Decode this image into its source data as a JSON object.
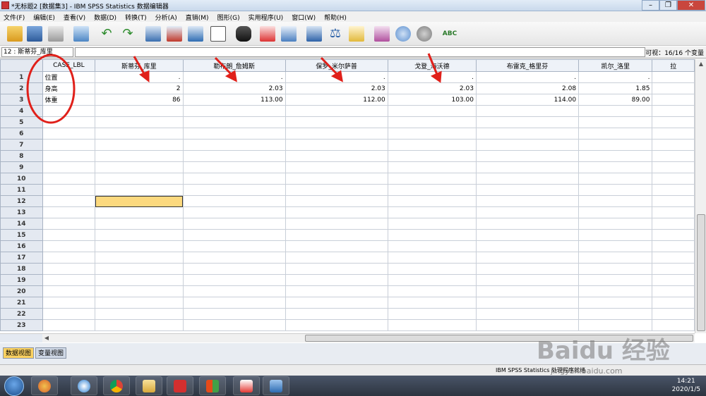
{
  "window": {
    "title": "*无标题2 [数据集3] - IBM SPSS Statistics 数据编辑器",
    "buttons": {
      "minimize": "–",
      "maximize": "❐",
      "close": "✕"
    }
  },
  "menu": [
    "文件(F)",
    "编辑(E)",
    "查看(V)",
    "数据(D)",
    "转换(T)",
    "分析(A)",
    "直销(M)",
    "图形(G)",
    "实用程序(U)",
    "窗口(W)",
    "帮助(H)"
  ],
  "toolbar": {
    "icons": [
      "open-icon",
      "save-icon",
      "print-icon",
      "dialog-recall-icon",
      "undo-icon",
      "redo-icon",
      "goto-case-icon",
      "goto-variable-icon",
      "variables-icon",
      "run-descriptives-icon",
      "find-icon",
      "insert-cases-icon",
      "insert-variable-icon",
      "split-file-icon",
      "weight-cases-icon",
      "select-cases-icon",
      "value-labels-icon",
      "use-sets-icon",
      "show-all-variables-icon",
      "spell-check-icon"
    ]
  },
  "editor": {
    "cell_ref": "12 : 斯蒂芬_库里",
    "cell_value": "",
    "visible": "可视：16/16 个变量"
  },
  "grid": {
    "columns": [
      "CASE_LBL",
      "斯蒂芬_库里",
      "勒布朗_詹姆斯",
      "保罗_米尔萨普",
      "戈登_海沃德",
      "布雷克_格里芬",
      "凯尔_洛里",
      "拉"
    ],
    "rows": [
      [
        "位置",
        ".",
        ".",
        ".",
        ".",
        ".",
        ".",
        ""
      ],
      [
        "身高",
        "2",
        "2.03",
        "2.03",
        "2.03",
        "2.08",
        "1.85",
        ""
      ],
      [
        "体重",
        "86",
        "113.00",
        "112.00",
        "103.00",
        "114.00",
        "89.00",
        ""
      ]
    ],
    "row_numbers": [
      "1",
      "2",
      "3",
      "4",
      "5",
      "6",
      "7",
      "8",
      "9",
      "10",
      "11",
      "12",
      "13",
      "14",
      "15",
      "16",
      "17",
      "18",
      "19",
      "20",
      "21",
      "22",
      "23"
    ],
    "selected": {
      "row": 12,
      "column": "斯蒂芬_库里"
    }
  },
  "tabs": {
    "data_view": "数据视图",
    "variable_view": "变量视图"
  },
  "status": {
    "text": "IBM SPSS Statistics 处理程序就绪"
  },
  "clock": {
    "time": "14:21",
    "date": "2020/1/5"
  },
  "watermark": {
    "brand": "Baidu 经验",
    "url": "jingyan.baidu.com"
  },
  "colors": {
    "selected_cell": "#fcd97e",
    "active_tab": "#fbd262",
    "annotation": "#e0201a"
  }
}
